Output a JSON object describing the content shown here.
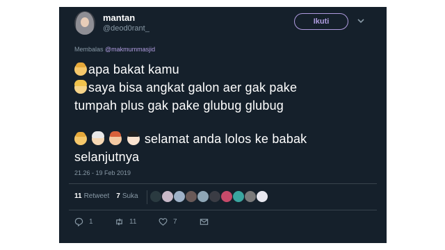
{
  "header": {
    "display_name": "mantan",
    "handle": "@deod0rant_",
    "follow_label": "Ikuti",
    "avatar_icon": "avatar-hijab-icon",
    "menu_icon": "chevron-down-icon"
  },
  "reply": {
    "prefix": "Membalas",
    "mention": "@makmummasjid"
  },
  "tweet": {
    "line1": "apa bakat kamu",
    "line2": "saya bisa angkat galon aer gak pake",
    "line3": "tumpah plus gak pake glubug glubug",
    "line4": "selamat anda lolos ke babak",
    "line5": "selanjutnya",
    "emojis": [
      "man-emoji",
      "woman-emoji",
      "man-emoji",
      "old-woman-emoji",
      "red-hair-man-emoji",
      "dark-hair-person-emoji"
    ]
  },
  "timestamp": "21.26 - 19 Feb 2019",
  "stats": {
    "retweets_count": "11",
    "retweets_label": "Retweet",
    "likes_count": "7",
    "likes_label": "Suka",
    "liker_colors": [
      "#2a3a40",
      "#c8b9c8",
      "#9fb2c8",
      "#6a5a58",
      "#8ea6b6",
      "#3a3c44",
      "#c64a6a",
      "#3aa6a0",
      "#7a7a7a",
      "#e8e8f0"
    ]
  },
  "actions": {
    "reply_count": "1",
    "retweet_count": "11",
    "like_count": "7"
  },
  "colors": {
    "background": "#15202b",
    "accent": "#b09ce0",
    "muted": "#8899a6"
  }
}
